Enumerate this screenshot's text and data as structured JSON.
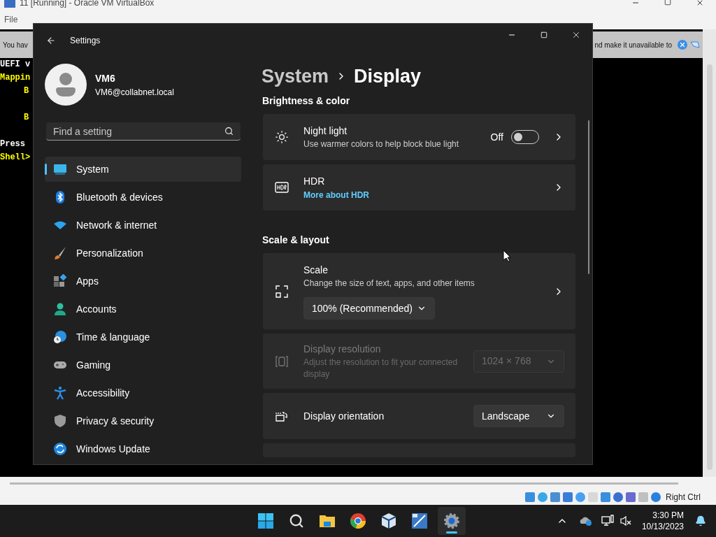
{
  "host_window": {
    "title": "11 [Running] - Oracle VM VirtualBox",
    "menu": [
      "File"
    ],
    "notice": {
      "left": "You hav",
      "right": "nd make it unavailable to"
    },
    "console": [
      {
        "text": "UEFI v",
        "color": "#ffffff",
        "kind": "plain"
      },
      {
        "text": "Mappin",
        "color": "#ffff00",
        "kind": "plain"
      },
      {
        "text": "B",
        "color": "#ffff00",
        "kind": "indented"
      },
      {
        "text": "B",
        "color": "#ffff00",
        "kind": "indented_after_blank"
      },
      {
        "text": "Press",
        "color": "#ffffff",
        "kind": "after_blank"
      },
      {
        "text": "Shell>",
        "color": "#ffff00",
        "kind": "plain"
      }
    ],
    "status_bar": {
      "host_key": "Right Ctrl"
    }
  },
  "settings": {
    "title": "Settings",
    "user": {
      "name": "VM6",
      "email": "VM6@collabnet.local"
    },
    "search": {
      "placeholder": "Find a setting"
    },
    "nav": [
      {
        "label": "System",
        "selected": true
      },
      {
        "label": "Bluetooth & devices",
        "selected": false
      },
      {
        "label": "Network & internet",
        "selected": false
      },
      {
        "label": "Personalization",
        "selected": false
      },
      {
        "label": "Apps",
        "selected": false
      },
      {
        "label": "Accounts",
        "selected": false
      },
      {
        "label": "Time & language",
        "selected": false
      },
      {
        "label": "Gaming",
        "selected": false
      },
      {
        "label": "Accessibility",
        "selected": false
      },
      {
        "label": "Privacy & security",
        "selected": false
      },
      {
        "label": "Windows Update",
        "selected": false
      }
    ],
    "breadcrumb": {
      "parent": "System",
      "current": "Display"
    },
    "sections": [
      {
        "heading": "Brightness & color",
        "cards": [
          {
            "kind": "toggle",
            "title": "Night light",
            "description": "Use warmer colors to help block blue light",
            "state_text": "Off",
            "on": false,
            "disabled": false
          },
          {
            "kind": "link",
            "title": "HDR",
            "link": "More about HDR",
            "disabled": false
          }
        ]
      },
      {
        "heading": "Scale & layout",
        "cards": [
          {
            "kind": "dropdown_below",
            "title": "Scale",
            "description": "Change the size of text, apps, and other items",
            "value": "100% (Recommended)",
            "disabled": false
          },
          {
            "kind": "dropdown",
            "title": "Display resolution",
            "description": "Adjust the resolution to fit your connected display",
            "value": "1024 × 768",
            "disabled": true
          },
          {
            "kind": "dropdown",
            "title": "Display orientation",
            "value": "Landscape",
            "disabled": false
          }
        ]
      }
    ]
  },
  "taskbar": {
    "time": "3:30 PM",
    "date": "10/13/2023"
  }
}
